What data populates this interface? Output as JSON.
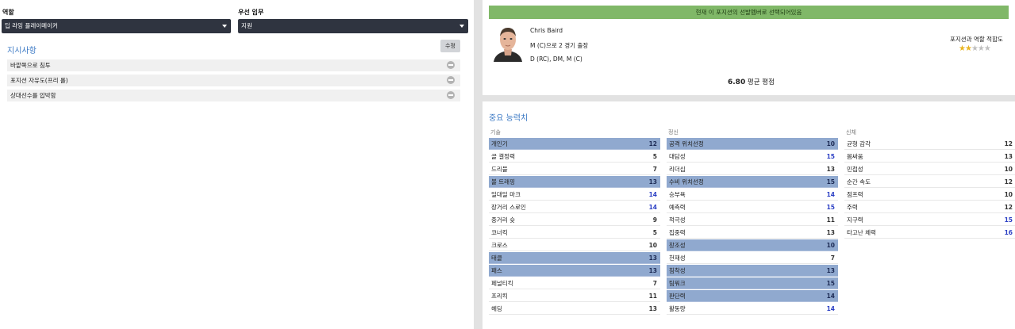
{
  "left": {
    "role_label": "역할",
    "role_value": "딥 라잉 플레이메이커",
    "duty_label": "우선 임무",
    "duty_value": "지원",
    "instructions_title": "지시사항",
    "edit_label": "수정",
    "instructions": [
      "바깥쪽으로 침투",
      "포지션 자유도(프리 롤)",
      "상대선수를 압박함"
    ]
  },
  "player": {
    "banner": "현재 이 포지션의 선발멤버로 선택되어있음",
    "name": "Chris Baird",
    "apps": "M (C)으로 2 경기 출장",
    "positions": "D (RC), DM, M (C)",
    "suitability_label": "포지션과 역할 적합도",
    "stars_filled": 2,
    "stars_total": 5,
    "avg_rating_value": "6.80",
    "avg_rating_label": "평균 평점"
  },
  "key_attributes": {
    "title": "중요 능력치",
    "technical": {
      "header": "기술",
      "rows": [
        {
          "name": "개인기",
          "value": "12",
          "hl": true
        },
        {
          "name": "골 결정력",
          "value": "5",
          "hl": false
        },
        {
          "name": "드리블",
          "value": "7",
          "hl": false
        },
        {
          "name": "볼 트래핑",
          "value": "13",
          "hl": true
        },
        {
          "name": "일대일 마크",
          "value": "14",
          "hl": false
        },
        {
          "name": "장거리 스로인",
          "value": "14",
          "hl": false
        },
        {
          "name": "중거리 슛",
          "value": "9",
          "hl": false
        },
        {
          "name": "코너킥",
          "value": "5",
          "hl": false
        },
        {
          "name": "크로스",
          "value": "10",
          "hl": false
        },
        {
          "name": "태클",
          "value": "13",
          "hl": true
        },
        {
          "name": "패스",
          "value": "13",
          "hl": true
        },
        {
          "name": "페널티킥",
          "value": "7",
          "hl": false
        },
        {
          "name": "프리킥",
          "value": "11",
          "hl": false
        },
        {
          "name": "헤딩",
          "value": "13",
          "hl": false
        }
      ]
    },
    "mental": {
      "header": "정신",
      "rows": [
        {
          "name": "공격 위치선정",
          "value": "10",
          "hl": true
        },
        {
          "name": "대담성",
          "value": "15",
          "hl": false
        },
        {
          "name": "리더십",
          "value": "13",
          "hl": false
        },
        {
          "name": "수비 위치선정",
          "value": "15",
          "hl": true
        },
        {
          "name": "승부욕",
          "value": "14",
          "hl": false
        },
        {
          "name": "예측력",
          "value": "15",
          "hl": false
        },
        {
          "name": "적극성",
          "value": "11",
          "hl": false
        },
        {
          "name": "집중력",
          "value": "13",
          "hl": false
        },
        {
          "name": "창조성",
          "value": "10",
          "hl": true
        },
        {
          "name": "천재성",
          "value": "7",
          "hl": false
        },
        {
          "name": "침착성",
          "value": "13",
          "hl": true
        },
        {
          "name": "팀워크",
          "value": "15",
          "hl": true
        },
        {
          "name": "판단력",
          "value": "14",
          "hl": true
        },
        {
          "name": "활동량",
          "value": "14",
          "hl": false
        }
      ]
    },
    "physical": {
      "header": "신체",
      "rows": [
        {
          "name": "균형 감각",
          "value": "12",
          "hl": false
        },
        {
          "name": "몸싸움",
          "value": "13",
          "hl": false
        },
        {
          "name": "민첩성",
          "value": "10",
          "hl": false
        },
        {
          "name": "순간 속도",
          "value": "12",
          "hl": false
        },
        {
          "name": "점프력",
          "value": "10",
          "hl": false
        },
        {
          "name": "주력",
          "value": "12",
          "hl": false
        },
        {
          "name": "지구력",
          "value": "15",
          "hl": false
        },
        {
          "name": "타고난 체력",
          "value": "16",
          "hl": false
        }
      ]
    }
  }
}
